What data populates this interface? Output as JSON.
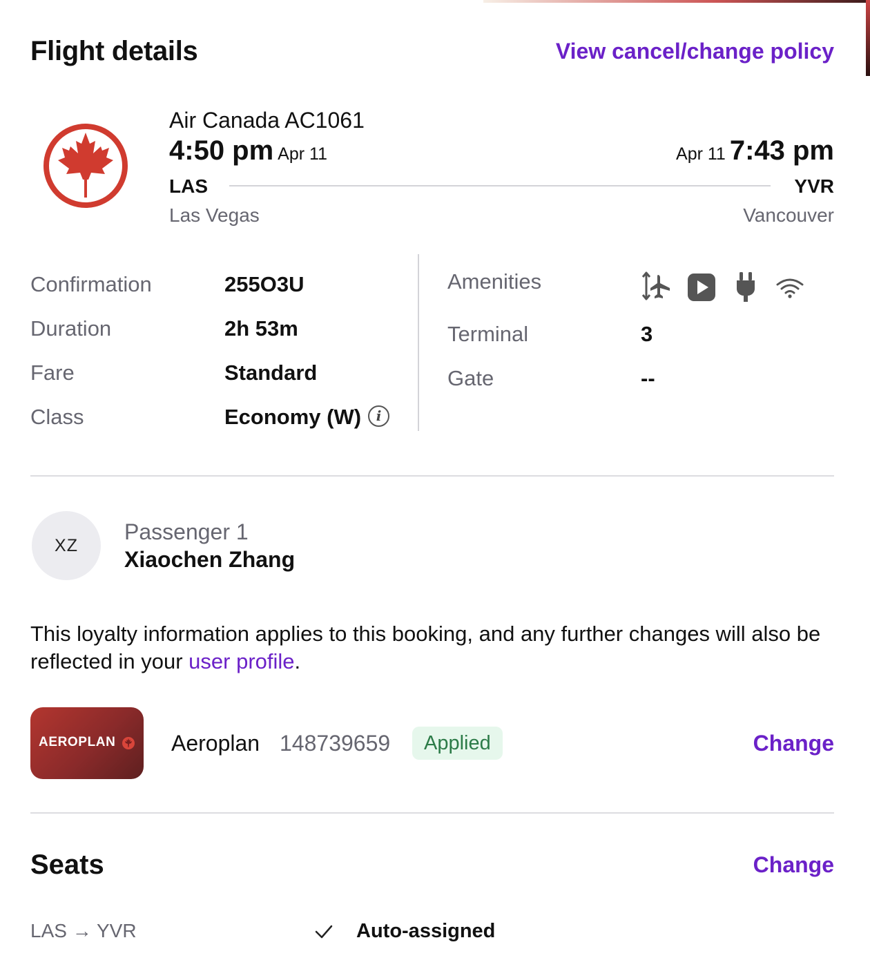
{
  "header": {
    "title": "Flight details",
    "policy_link": "View cancel/change policy"
  },
  "flight": {
    "airline_logo": "air-canada-maple-leaf-logo",
    "airline": "Air Canada AC1061",
    "departure_time": "4:50 pm",
    "departure_date": "Apr 11",
    "arrival_date": "Apr 11",
    "arrival_time": "7:43 pm",
    "origin_code": "LAS",
    "destination_code": "YVR",
    "origin_city": "Las Vegas",
    "destination_city": "Vancouver"
  },
  "details": {
    "confirmation_label": "Confirmation",
    "confirmation_value": "255O3U",
    "duration_label": "Duration",
    "duration_value": "2h 53m",
    "fare_label": "Fare",
    "fare_value": "Standard",
    "class_label": "Class",
    "class_value": "Economy (W)",
    "class_info_icon": "info-icon",
    "amenities_label": "Amenities",
    "amenities": [
      "seat-recline-icon",
      "video-play-icon",
      "power-plug-icon",
      "wifi-icon"
    ],
    "terminal_label": "Terminal",
    "terminal_value": "3",
    "gate_label": "Gate",
    "gate_value": "--"
  },
  "passenger": {
    "initials": "XZ",
    "label": "Passenger 1",
    "name": "Xiaochen Zhang"
  },
  "loyalty": {
    "text_before": "This loyalty information applies to this booking, and any further changes will also be reflected in your ",
    "link": "user profile",
    "text_after": ".",
    "card_logo_text": "AEROPLAN",
    "program": "Aeroplan",
    "number": "148739659",
    "status": "Applied",
    "change_label": "Change"
  },
  "seats": {
    "title": "Seats",
    "change_label": "Change",
    "segment": "LAS → YVR",
    "status": "Auto-assigned"
  },
  "colors": {
    "accent": "#6b21c8",
    "airline_red": "#d03b2f",
    "badge_bg": "#e6f7ec",
    "badge_text": "#2c7b48",
    "muted_text": "#666670"
  }
}
